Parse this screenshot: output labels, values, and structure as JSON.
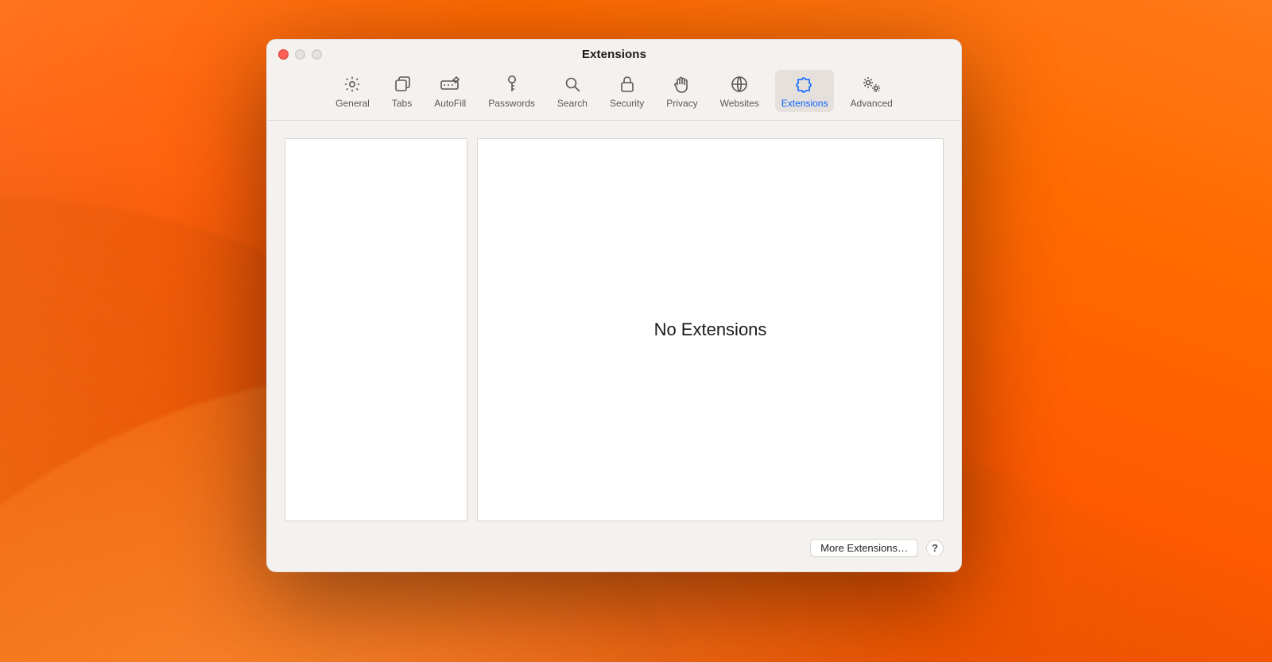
{
  "window": {
    "title": "Extensions"
  },
  "tabs": {
    "general": {
      "label": "General"
    },
    "tabs": {
      "label": "Tabs"
    },
    "autofill": {
      "label": "AutoFill"
    },
    "passwords": {
      "label": "Passwords"
    },
    "search": {
      "label": "Search"
    },
    "security": {
      "label": "Security"
    },
    "privacy": {
      "label": "Privacy"
    },
    "websites": {
      "label": "Websites"
    },
    "extensions": {
      "label": "Extensions"
    },
    "advanced": {
      "label": "Advanced"
    }
  },
  "main": {
    "empty_message": "No Extensions"
  },
  "footer": {
    "more_button": "More Extensions…",
    "help_button": "?"
  }
}
